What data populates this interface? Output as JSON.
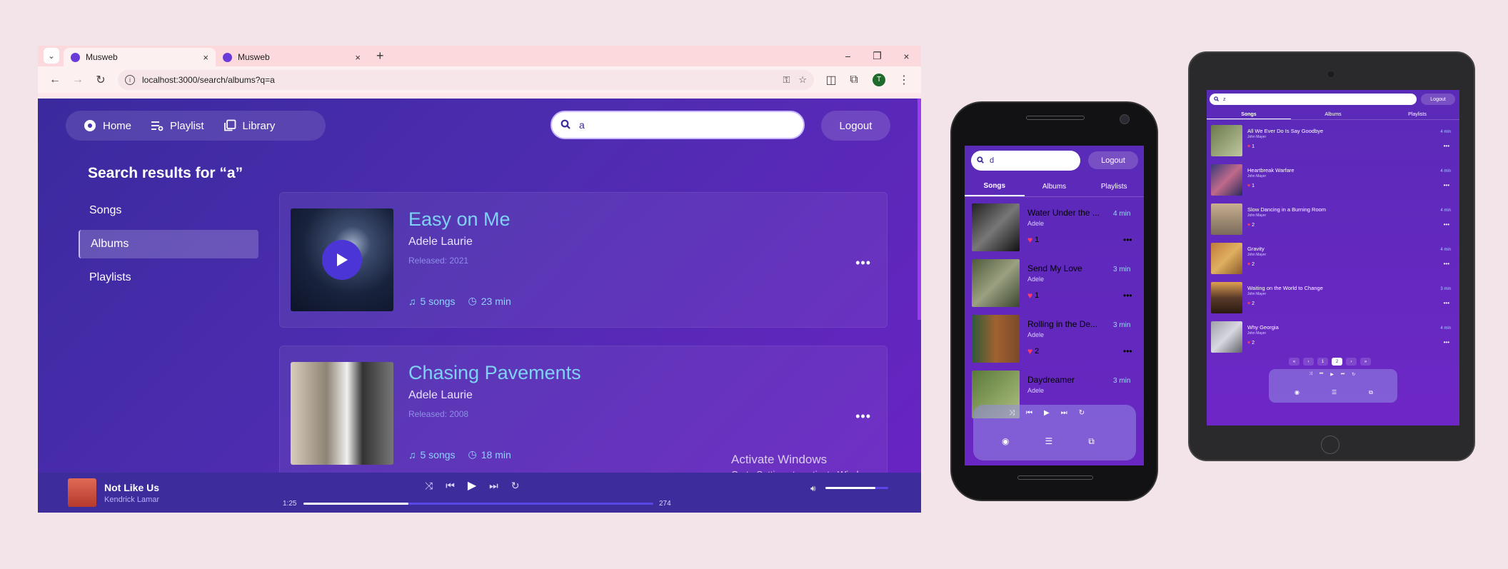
{
  "browser": {
    "tabs": [
      {
        "label": "Musweb",
        "close": "×"
      },
      {
        "label": "Musweb",
        "close": "×"
      }
    ],
    "new_tab": "+",
    "window_controls": {
      "minimize": "−",
      "restore": "❐",
      "close": "×"
    },
    "url": "localhost:3000/search/albums?q=a",
    "profile_initial": "T"
  },
  "app": {
    "nav": [
      {
        "label": "Home",
        "icon": "disc-icon"
      },
      {
        "label": "Playlist",
        "icon": "playlist-icon"
      },
      {
        "label": "Library",
        "icon": "library-icon"
      }
    ],
    "search_value": "a",
    "logout_label": "Logout",
    "results_title": "Search results for “a”",
    "side_menu": [
      "Songs",
      "Albums",
      "Playlists"
    ],
    "side_menu_active": "Albums",
    "albums": [
      {
        "title": "Easy on Me",
        "artist": "Adele Laurie",
        "released": "Released: 2021",
        "songs": "5 songs",
        "duration": "23 min"
      },
      {
        "title": "Chasing Pavements",
        "artist": "Adele Laurie",
        "released": "Released: 2008",
        "songs": "5 songs",
        "duration": "18 min"
      }
    ],
    "player": {
      "title": "Not Like Us",
      "artist": "Kendrick Lamar",
      "elapsed": "1:25",
      "total": "274",
      "progress_fraction": 0.3,
      "volume_fraction": 0.8
    },
    "watermark": {
      "line1": "Activate Windows",
      "line2": "Go to Settings to activate Windows."
    }
  },
  "phone": {
    "search_value": "d",
    "logout_label": "Logout",
    "tabs": [
      "Songs",
      "Albums",
      "Playlists"
    ],
    "active_tab": "Songs",
    "songs": [
      {
        "title": "Water Under the ...",
        "artist": "Adele",
        "likes": "1",
        "duration": "4 min"
      },
      {
        "title": "Send My Love",
        "artist": "Adele",
        "likes": "1",
        "duration": "3 min"
      },
      {
        "title": "Rolling in the De...",
        "artist": "Adele",
        "likes": "2",
        "duration": "3 min"
      },
      {
        "title": "Daydreamer",
        "artist": "Adele",
        "likes": "",
        "duration": "3 min"
      }
    ]
  },
  "tablet": {
    "search_value": "z",
    "logout_label": "Logout",
    "tabs": [
      "Songs",
      "Albums",
      "Playlists"
    ],
    "active_tab": "Songs",
    "songs": [
      {
        "title": "All We Ever Do Is Say Goodbye",
        "artist": "John Mayer",
        "likes": "1",
        "duration": "4 min"
      },
      {
        "title": "Heartbreak Warfare",
        "artist": "John Mayer",
        "likes": "1",
        "duration": "4 min"
      },
      {
        "title": "Slow Dancing in a Burning Room",
        "artist": "John Mayer",
        "likes": "2",
        "duration": "4 min"
      },
      {
        "title": "Gravity",
        "artist": "John Mayer",
        "likes": "2",
        "duration": "4 min"
      },
      {
        "title": "Waiting on the World to Change",
        "artist": "John Mayer",
        "likes": "2",
        "duration": "3 min"
      },
      {
        "title": "Why Georgia",
        "artist": "John Mayer",
        "likes": "2",
        "duration": "4 min"
      }
    ],
    "pages": [
      "1",
      "2"
    ],
    "active_page": "2"
  },
  "colors": {
    "accent": "#4c35d6",
    "title_cyan": "#7fd2f6",
    "heart": "#ff3b6b"
  }
}
